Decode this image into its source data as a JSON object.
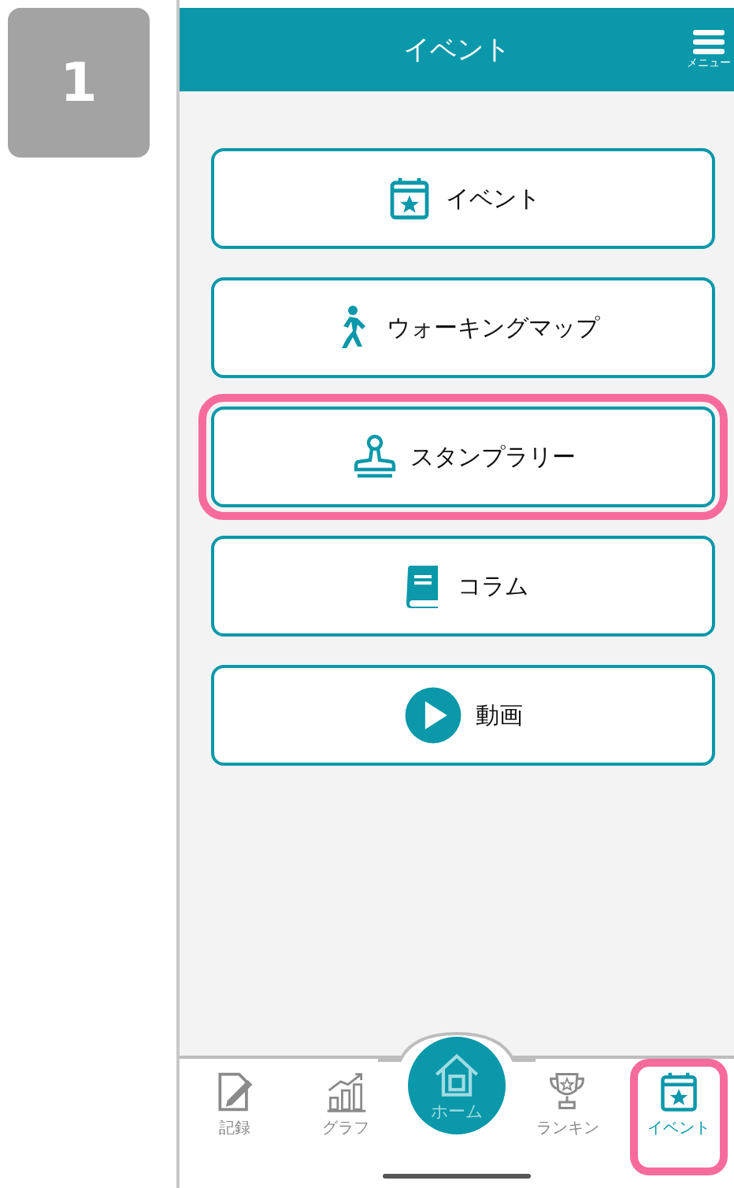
{
  "step_badge": "1",
  "header": {
    "title": "イベント",
    "menu_label": "メニュー"
  },
  "menu_buttons": [
    {
      "kind": "calendar",
      "label": "イベント",
      "highlighted": false
    },
    {
      "kind": "walk",
      "label": "ウォーキングマップ",
      "highlighted": false
    },
    {
      "kind": "stamp",
      "label": "スタンプラリー",
      "highlighted": true
    },
    {
      "kind": "book",
      "label": "コラム",
      "highlighted": false
    },
    {
      "kind": "play",
      "label": "動画",
      "highlighted": false
    }
  ],
  "tab_bar": [
    {
      "kind": "record",
      "label": "記録",
      "selected": false,
      "highlighted": false
    },
    {
      "kind": "graph",
      "label": "グラフ",
      "selected": false,
      "highlighted": false
    },
    {
      "kind": "home",
      "label": "ホーム",
      "selected": false,
      "highlighted": false
    },
    {
      "kind": "trophy",
      "label": "ランキン",
      "selected": false,
      "highlighted": false
    },
    {
      "kind": "calendar",
      "label": "イベント",
      "selected": true,
      "highlighted": true
    }
  ]
}
